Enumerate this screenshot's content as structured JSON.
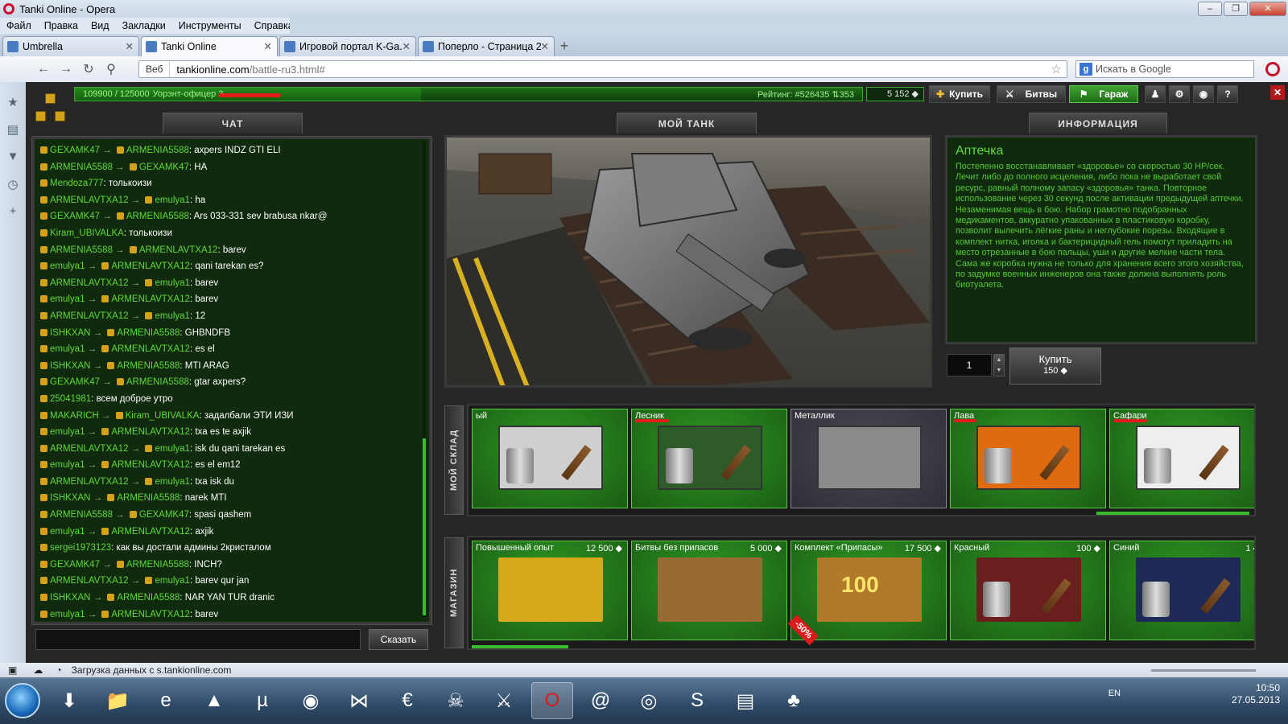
{
  "window": {
    "title": "Tanki Online - Opera"
  },
  "menu": [
    "Файл",
    "Правка",
    "Вид",
    "Закладки",
    "Инструменты",
    "Справка"
  ],
  "tabs": [
    {
      "label": "Umbrella",
      "active": false
    },
    {
      "label": "Tanki Online",
      "active": true
    },
    {
      "label": "Игровой портал K-Ga...",
      "active": false
    },
    {
      "label": "Поперло - Страница 2...",
      "active": false
    }
  ],
  "address": {
    "scheme_label": "Веб",
    "host": "tankionline.com",
    "path": "/battle-ru3.html#",
    "search_placeholder": "Искать в Google"
  },
  "game": {
    "xp": "109900 / 125000",
    "rank": "Уорэнт-офицер 3",
    "xp_progress": 0.879,
    "rating": "Рейтинг: #526435",
    "rating_change": "353",
    "crystals": "5 152",
    "buttons": {
      "buy": "Купить",
      "battles": "Битвы",
      "garage": "Гараж"
    },
    "section_tabs": {
      "chat": "ЧАТ",
      "my_tank": "МОЙ ТАНК",
      "info": "ИНФОРМАЦИЯ",
      "warehouse": "МОЙ СКЛАД",
      "shop": "МАГАЗИН"
    },
    "chat": [
      {
        "from": "GEXAMK47",
        "to": "ARMENIA5588",
        "msg": "axpers INDZ GTI ELI"
      },
      {
        "from": "ARMENIA5588",
        "to": "GEXAMK47",
        "msg": "HA"
      },
      {
        "from": "Mendoza777",
        "to": "",
        "msg": "толькоизи"
      },
      {
        "from": "ARMENLAVTXA12",
        "to": "emulya1",
        "msg": "ha"
      },
      {
        "from": "GEXAMK47",
        "to": "ARMENIA5588",
        "msg": "Ars 033-331 sev brabusa nkar@"
      },
      {
        "from": "Kiram_UBIVALKA",
        "to": "",
        "msg": "толькоизи"
      },
      {
        "from": "ARMENIA5588",
        "to": "ARMENLAVTXA12",
        "msg": "barev"
      },
      {
        "from": "emulya1",
        "to": "ARMENLAVTXA12",
        "msg": "qani tarekan es?"
      },
      {
        "from": "ARMENLAVTXA12",
        "to": "emulya1",
        "msg": "barev"
      },
      {
        "from": "emulya1",
        "to": "ARMENLAVTXA12",
        "msg": "barev"
      },
      {
        "from": "ARMENLAVTXA12",
        "to": "emulya1",
        "msg": "12"
      },
      {
        "from": "ISHKXAN",
        "to": "ARMENIA5588",
        "msg": "GHBNDFB"
      },
      {
        "from": "emulya1",
        "to": "ARMENLAVTXA12",
        "msg": "es el"
      },
      {
        "from": "ISHKXAN",
        "to": "ARMENIA5588",
        "msg": "MTI ARAG"
      },
      {
        "from": "GEXAMK47",
        "to": "ARMENIA5588",
        "msg": "gtar axpers?"
      },
      {
        "from": "25041981",
        "to": "",
        "msg": "всем доброе утро"
      },
      {
        "from": "MAKARICH",
        "to": "Kiram_UBIVALKA",
        "msg": "задалбали ЭТИ ИЗИ"
      },
      {
        "from": "emulya1",
        "to": "ARMENLAVTXA12",
        "msg": "txa es te axjik"
      },
      {
        "from": "ARMENLAVTXA12",
        "to": "emulya1",
        "msg": "isk du qani tarekan es"
      },
      {
        "from": "emulya1",
        "to": "ARMENLAVTXA12",
        "msg": "es el em12"
      },
      {
        "from": "ARMENLAVTXA12",
        "to": "emulya1",
        "msg": "txa isk du"
      },
      {
        "from": "ISHKXAN",
        "to": "ARMENIA5588",
        "msg": "narek MTI"
      },
      {
        "from": "ARMENIA5588",
        "to": "GEXAMK47",
        "msg": "spasi qashem"
      },
      {
        "from": "emulya1",
        "to": "ARMENLAVTXA12",
        "msg": "axjik"
      },
      {
        "from": "sergei1973123",
        "to": "",
        "msg": "как вы достали админы 2кристалом"
      },
      {
        "from": "GEXAMK47",
        "to": "ARMENIA5588",
        "msg": "INCH?"
      },
      {
        "from": "ARMENLAVTXA12",
        "to": "emulya1",
        "msg": "barev qur jan"
      },
      {
        "from": "ISHKXAN",
        "to": "ARMENIA5588",
        "msg": "NAR YAN TUR dranic"
      },
      {
        "from": "emulya1",
        "to": "ARMENLAVTXA12",
        "msg": "barev"
      }
    ],
    "say_label": "Сказать",
    "info": {
      "title": "Аптечка",
      "text": "Постепенно восстанавливает «здоровье» со скоростью 30 HP/сек. Лечит либо до полного исцеления, либо пока не выработает свой ресурс, равный полному запасу «здоровья» танка. Повторное использование через 30 секунд после активации предыдущей аптечки.\nНезаменимая вещь в бою. Набор грамотно подобранных медикаментов, аккуратно упакованных в пластиковую коробку, позволит вылечить лёгкие раны и неглубокие порезы. Входящие в комплект нитка, иголка и бактерицидный гель помогут приладить на место отрезанные в бою пальцы, уши и другие мелкие части тела. Сама же коробка нужна не только для хранения всего этого хозяйства, по задумке военных инженеров она также должна выполнять роль биотуалета.",
      "quantity": "1",
      "buy_label": "Купить",
      "price": "150"
    },
    "warehouse": [
      {
        "name": "ый",
        "color": "#cfcfcf",
        "selected": false
      },
      {
        "name": "Лесник",
        "color": "#2f5a2a",
        "selected": false
      },
      {
        "name": "Металлик",
        "color": "#8a8a8a",
        "selected": true
      },
      {
        "name": "Лава",
        "color": "#e06a10",
        "selected": false
      },
      {
        "name": "Сафари",
        "color": "#eeeeee",
        "selected": false
      }
    ],
    "shop": [
      {
        "name": "Повышенный опыт",
        "price": "12 500",
        "color": "#d6a81c"
      },
      {
        "name": "Битвы без припасов",
        "price": "5 000",
        "color": "#9a6a35"
      },
      {
        "name": "Комплект «Припасы»",
        "price": "17 500",
        "color": "#b07a2a",
        "badge": "-50%",
        "big": "100"
      },
      {
        "name": "Красный",
        "price": "100",
        "color": "#6a1e1e"
      },
      {
        "name": "Синий",
        "price": "1",
        "color": "#1e2a55"
      }
    ]
  },
  "status": {
    "text": "Загрузка данных с s.tankionline.com"
  },
  "tray": {
    "lang": "EN",
    "time": "10:50",
    "date": "27.05.2013"
  }
}
